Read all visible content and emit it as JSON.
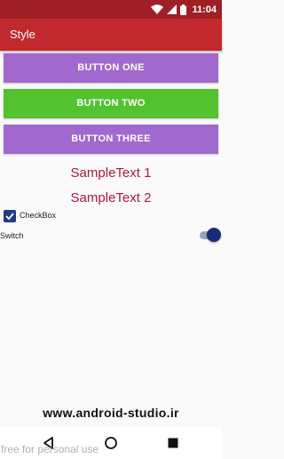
{
  "status_bar": {
    "time": "11:04",
    "icons": [
      "wifi-icon",
      "signal-icon",
      "battery-icon"
    ],
    "color": "#9e1f26"
  },
  "app_bar": {
    "title": "Style",
    "color": "#c2292f"
  },
  "buttons": [
    {
      "label": "BUTTON ONE",
      "color": "#a169cd"
    },
    {
      "label": "BUTTON TWO",
      "color": "#52c22e"
    },
    {
      "label": "BUTTON THREE",
      "color": "#a169cd"
    }
  ],
  "texts": [
    {
      "value": "SampleText 1",
      "color": "#b0173a"
    },
    {
      "value": "SampleText 2",
      "color": "#b0173a"
    }
  ],
  "checkbox": {
    "label": "CheckBox",
    "checked": true
  },
  "switch": {
    "label": "Switch",
    "on": true
  },
  "watermark": "www.android-studio.ir",
  "footer_text": "free for personal use",
  "nav_bar": {
    "icons": [
      "back-icon",
      "home-icon",
      "recent-apps-icon"
    ]
  }
}
